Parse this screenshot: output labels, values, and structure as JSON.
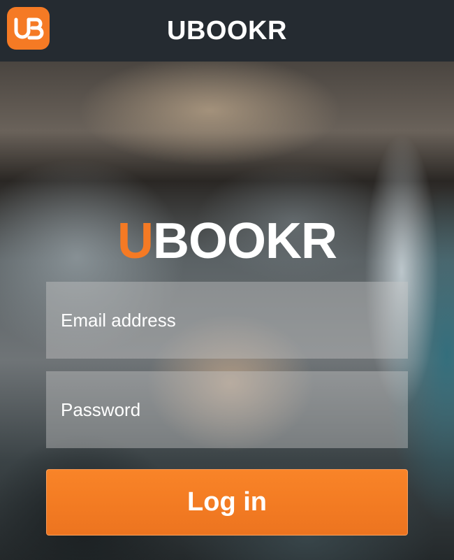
{
  "header": {
    "title": "UBOOKR",
    "app_icon": {
      "name": "ub-logo-icon",
      "letters": "UB"
    }
  },
  "hero": {
    "logo_accent": "U",
    "logo_rest": "BOOKR"
  },
  "form": {
    "email_placeholder": "Email address",
    "email_value": "",
    "password_placeholder": "Password",
    "password_value": "",
    "login_label": "Log in"
  },
  "colors": {
    "brand_orange": "#f57a24",
    "topbar": "#252b31",
    "text": "#ffffff"
  }
}
